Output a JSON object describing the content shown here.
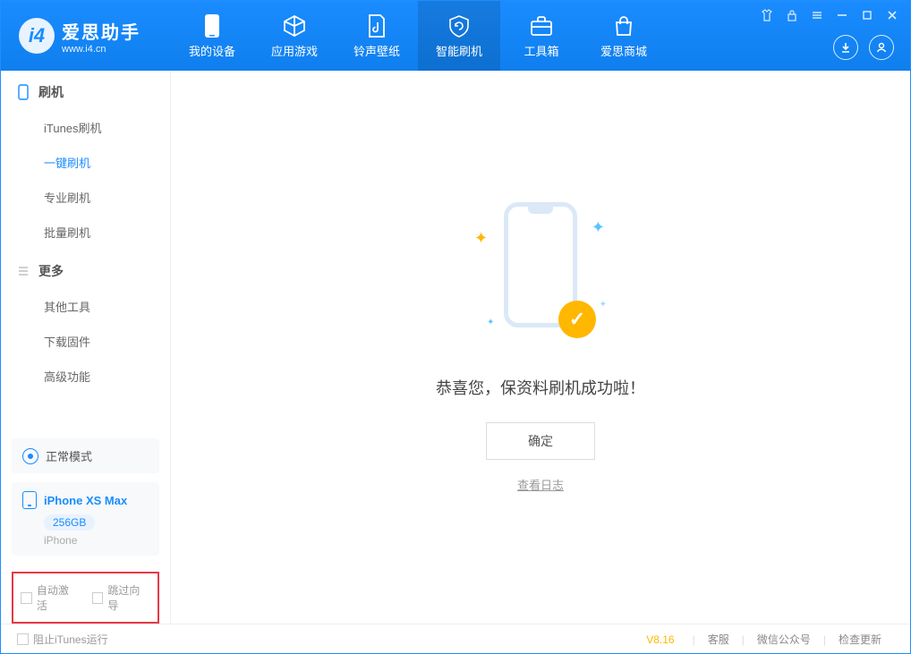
{
  "app": {
    "name": "爱思助手",
    "url": "www.i4.cn"
  },
  "nav": {
    "device": "我的设备",
    "apps": "应用游戏",
    "ringtones": "铃声壁纸",
    "flash": "智能刷机",
    "toolbox": "工具箱",
    "store": "爱思商城"
  },
  "sidebar": {
    "section_flash": "刷机",
    "items_flash": {
      "itunes": "iTunes刷机",
      "oneclick": "一键刷机",
      "pro": "专业刷机",
      "batch": "批量刷机"
    },
    "section_more": "更多",
    "items_more": {
      "other": "其他工具",
      "firmware": "下载固件",
      "advanced": "高级功能"
    },
    "status_mode": "正常模式",
    "device": {
      "name": "iPhone XS Max",
      "capacity": "256GB",
      "type": "iPhone"
    },
    "checkboxes": {
      "auto_activate": "自动激活",
      "skip_guide": "跳过向导"
    }
  },
  "main": {
    "success_message": "恭喜您，保资料刷机成功啦！",
    "confirm_label": "确定",
    "view_log_label": "查看日志"
  },
  "footer": {
    "block_itunes": "阻止iTunes运行",
    "version": "V8.16",
    "support": "客服",
    "wechat": "微信公众号",
    "update": "检查更新"
  }
}
